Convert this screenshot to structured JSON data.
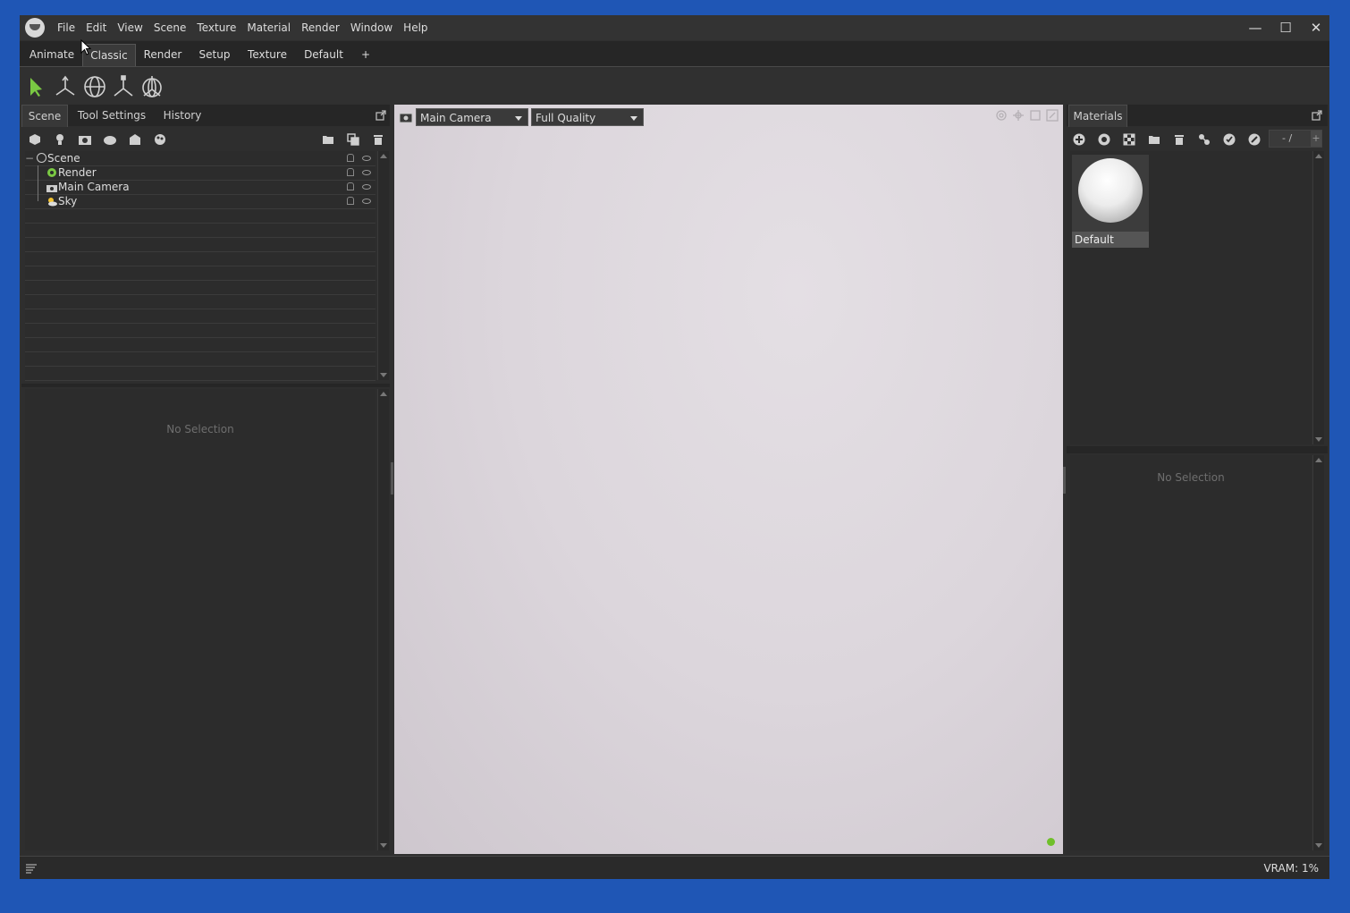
{
  "menu": [
    "File",
    "Edit",
    "View",
    "Scene",
    "Texture",
    "Material",
    "Render",
    "Window",
    "Help"
  ],
  "window_controls": {
    "minimize": "—",
    "maximize": "☐",
    "close": "✕"
  },
  "layout_tabs": [
    "Animate",
    "Classic",
    "Render",
    "Setup",
    "Texture",
    "Default",
    "+"
  ],
  "active_layout_tab": "Classic",
  "left_panel": {
    "tabs": [
      "Scene",
      "Tool Settings",
      "History"
    ],
    "active_tab": "Scene",
    "tree": [
      {
        "label": "Scene",
        "icon": "scene-node-icon"
      },
      {
        "label": "Render",
        "icon": "render-gear-icon"
      },
      {
        "label": "Main Camera",
        "icon": "camera-icon"
      },
      {
        "label": "Sky",
        "icon": "sun-cloud-icon"
      }
    ],
    "properties_empty": "No Selection"
  },
  "viewport": {
    "camera_select": "Main Camera",
    "quality_select": "Full Quality",
    "status_color": "#6fbf2a"
  },
  "right_panel": {
    "tabs": [
      "Materials"
    ],
    "pager": "- /",
    "materials": [
      {
        "name": "Default"
      }
    ],
    "properties_empty": "No Selection"
  },
  "status": {
    "vram": "VRAM: 1%"
  },
  "colors": {
    "accent_green": "#7ac943",
    "background_blue": "#1f56b5"
  }
}
